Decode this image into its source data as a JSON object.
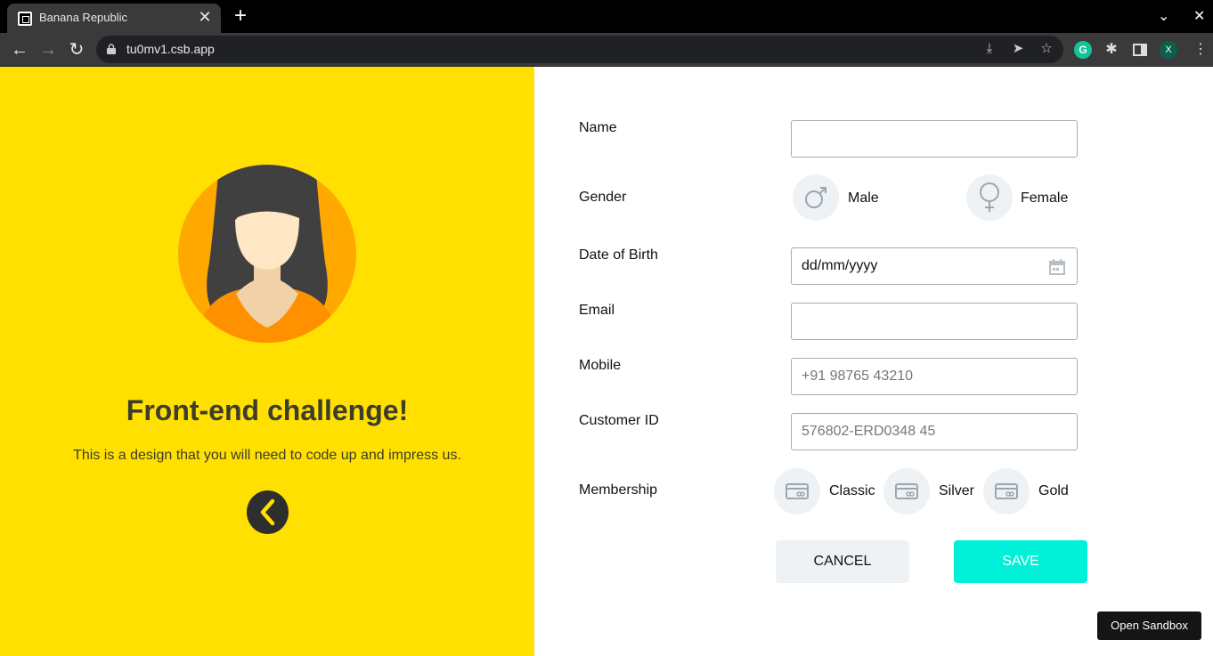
{
  "browser": {
    "tab_title": "Banana Republic",
    "url": "tu0mv1.csb.app",
    "profile_initial": "X",
    "grammarly_letter": "G"
  },
  "hero": {
    "headline": "Front-end challenge!",
    "subtext": "This is a design that you will need to code up and impress us."
  },
  "form": {
    "name_label": "Name",
    "name_value": "",
    "gender_label": "Gender",
    "gender_options": [
      "Male",
      "Female"
    ],
    "dob_label": "Date of Birth",
    "dob_value": "dd/mm/yyyy",
    "email_label": "Email",
    "email_value": "",
    "mobile_label": "Mobile",
    "mobile_placeholder": "+91 98765 43210",
    "customer_id_label": "Customer ID",
    "customer_id_placeholder": "576802-ERD0348 45",
    "membership_label": "Membership",
    "membership_options": [
      "Classic",
      "Silver",
      "Gold"
    ],
    "cancel_label": "CANCEL",
    "save_label": "SAVE"
  },
  "sandbox_button": "Open Sandbox",
  "colors": {
    "panel": "#ffe000",
    "save": "#00f0d8",
    "icon_bg": "#eef2f4"
  }
}
